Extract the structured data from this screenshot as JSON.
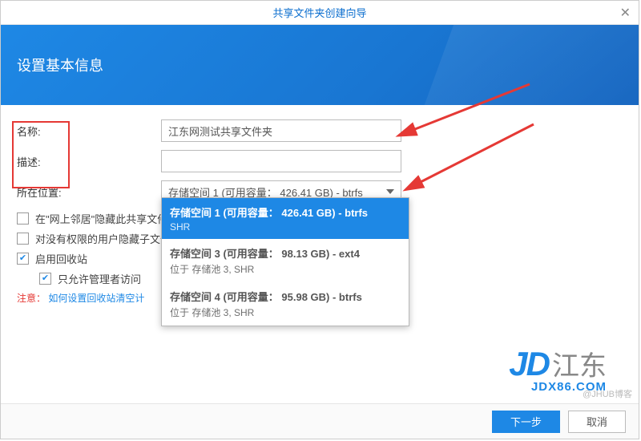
{
  "titlebar": "共享文件夹创建向导",
  "header": "设置基本信息",
  "labels": {
    "name": "名称:",
    "desc": "描述:",
    "location": "所在位置:"
  },
  "inputs": {
    "name_value": "江东网测试共享文件夹",
    "desc_value": "",
    "location_value": "存储空间 1 (可用容量： 426.41 GB) - btrfs"
  },
  "checks": {
    "hide_neighbor": "在\"网上邻居\"隐藏此共享文件",
    "hide_noperm": "对没有权限的用户隐藏子文件",
    "enable_recycle": "启用回收站",
    "admin_only": "只允许管理者访问"
  },
  "note_prefix": "注意：",
  "note_link": "如何设置回收站清空计",
  "dropdown": [
    {
      "main": "存储空间 1 (可用容量： 426.41 GB) - btrfs",
      "sub": "SHR",
      "sel": true
    },
    {
      "main": "存储空间 3 (可用容量： 98.13 GB) - ext4",
      "sub": "位于 存储池 3, SHR",
      "sel": false
    },
    {
      "main": "存储空间 4 (可用容量： 95.98 GB) - btrfs",
      "sub": "位于 存储池 3, SHR",
      "sel": false
    }
  ],
  "buttons": {
    "next": "下一步",
    "cancel": "取消"
  },
  "logo": {
    "jd": "JD",
    "cn": "江东",
    "sub": "JDX86.COM"
  },
  "watermark": "@JHUB博客"
}
